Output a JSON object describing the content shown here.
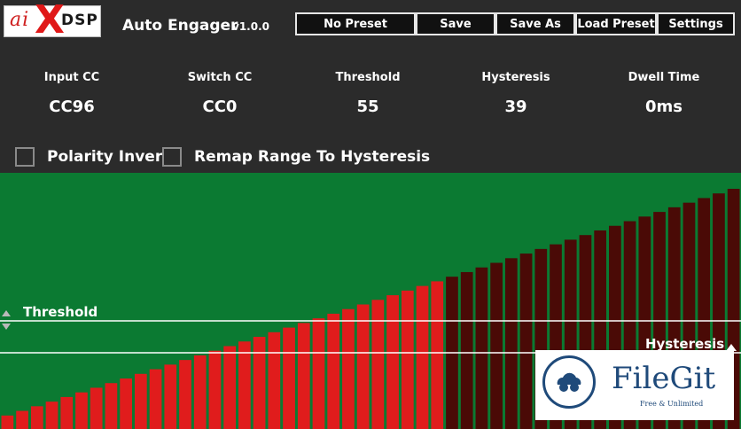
{
  "logo": {
    "ai": "ai",
    "x": "X",
    "dsp": "DSP"
  },
  "app": {
    "title": "Auto Engager",
    "version": "v1.0.0"
  },
  "toolbar": {
    "buttons": [
      {
        "label": "No Preset"
      },
      {
        "label": "Save"
      },
      {
        "label": "Save As"
      },
      {
        "label": "Load Preset"
      },
      {
        "label": "Settings"
      }
    ]
  },
  "params": [
    {
      "label": "Input CC",
      "value": "CC96"
    },
    {
      "label": "Switch CC",
      "value": "CC0"
    },
    {
      "label": "Threshold",
      "value": "55"
    },
    {
      "label": "Hysteresis",
      "value": "39"
    },
    {
      "label": "Dwell Time",
      "value": "0ms"
    }
  ],
  "options": {
    "polarity_invert": {
      "label": "Polarity Invert",
      "checked": false
    },
    "remap_range": {
      "label": "Remap Range To Hysteresis",
      "checked": false
    }
  },
  "graph": {
    "threshold_label": "Threshold",
    "hysteresis_label": "Hysteresis",
    "bar_count": 50,
    "active_bar_count": 30,
    "colors": {
      "background": "#0b7a32",
      "bar_active": "#e01c1c",
      "bar_inactive": "#4a0a06",
      "lines": "#ffffff"
    }
  },
  "watermark": {
    "title": "FileGit",
    "subtitle": "Free & Unlimited"
  }
}
